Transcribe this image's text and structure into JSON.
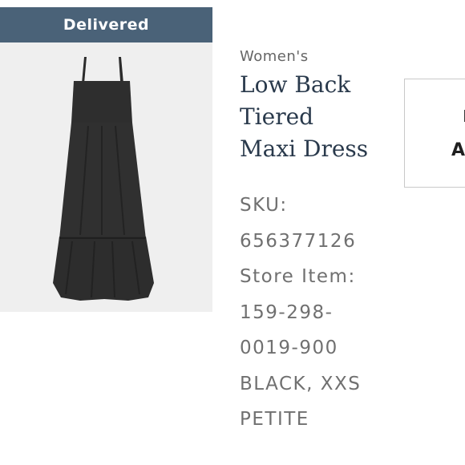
{
  "order_item": {
    "status": "Delivered",
    "category": "Women's",
    "product_name_lines": [
      "Low Back",
      "Tiered",
      "Maxi Dress"
    ],
    "sku_label": "SKU:",
    "sku_value": "656377126",
    "store_item_label": "Store Item:",
    "store_item_line1": "159-298-",
    "store_item_line2": "0019-900",
    "variant_line1": "BLACK, XXS",
    "variant_line2": "PETITE",
    "action_line1": "I",
    "action_line2": "A",
    "image_alt_icon": "dress-image"
  },
  "colors": {
    "status_banner_bg": "#4a6278",
    "title_color": "#2a3a4c",
    "meta_color": "#707070",
    "image_bg": "#efefef"
  }
}
